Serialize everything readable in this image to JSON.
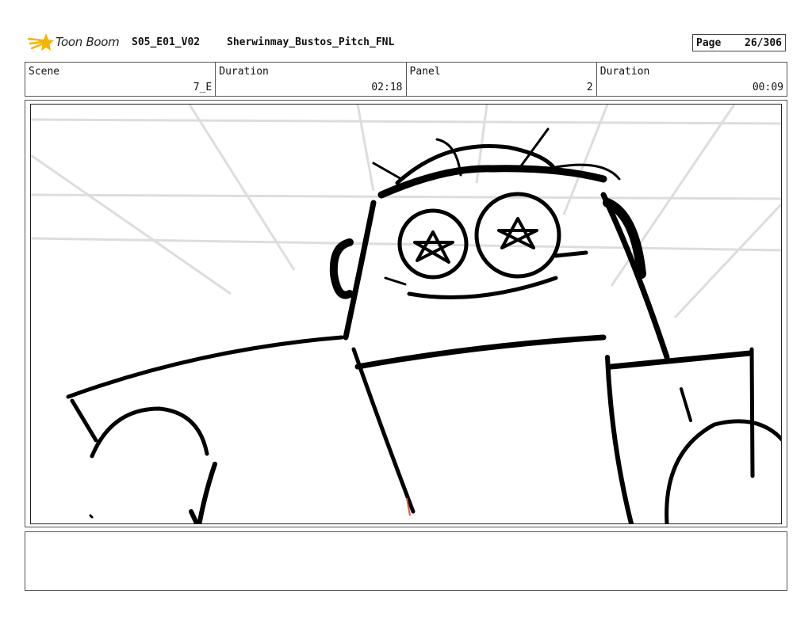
{
  "header": {
    "logo_text": "Toon Boom",
    "project_title": "S05_E01_V02",
    "file_title": "Sherwinmay_Bustos_Pitch_FNL",
    "page_label": "Page",
    "page_value": "26/306"
  },
  "info": {
    "scene_label": "Scene",
    "scene_value": "7_E",
    "scene_duration_label": "Duration",
    "scene_duration_value": "02:18",
    "panel_label": "Panel",
    "panel_value": "2",
    "panel_duration_label": "Duration",
    "panel_duration_value": "00:09"
  },
  "notes": {
    "text": ""
  },
  "colors": {
    "sketch": "#000000",
    "guides": "#dddddd",
    "accent": "#e0533a",
    "logo_star": "#f5b400"
  }
}
